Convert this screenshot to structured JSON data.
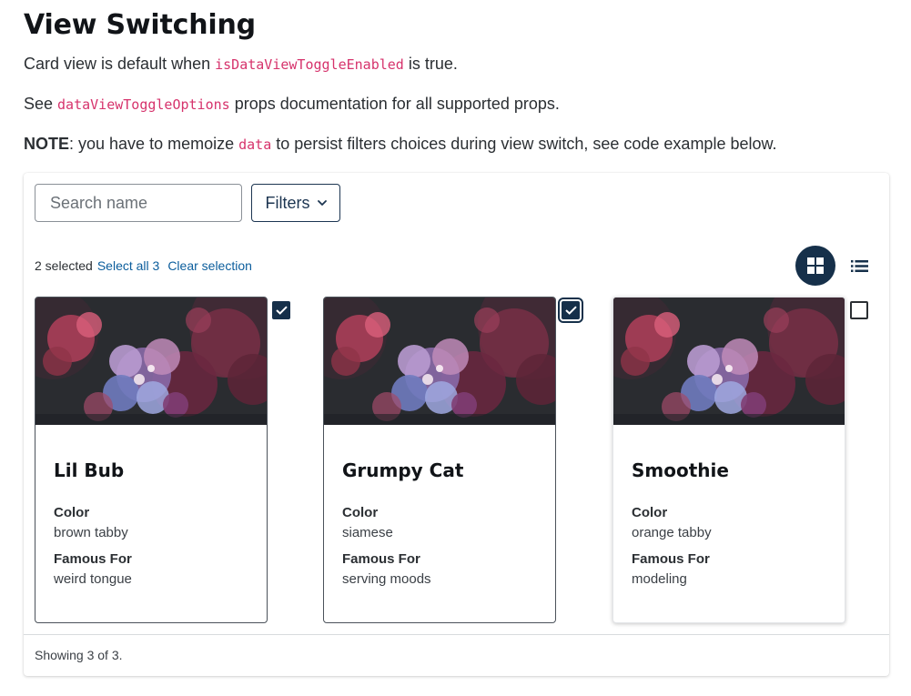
{
  "heading": "View Switching",
  "para1": {
    "before": "Card view is default when ",
    "code": "isDataViewToggleEnabled",
    "after": " is true."
  },
  "para2": {
    "before": "See ",
    "code": "dataViewToggleOptions",
    "after": " props documentation for all supported props."
  },
  "para3": {
    "bold": "NOTE",
    "before": ": you have to memoize ",
    "code": "data",
    "after": " to persist filters choices during view switch, see code example below."
  },
  "toolbar": {
    "search_placeholder": "Search name",
    "search_value": "",
    "filters_label": "Filters"
  },
  "selection": {
    "count_text": "2 selected",
    "select_all": "Select all 3",
    "clear": "Clear selection"
  },
  "view_toggle": {
    "active": "grid",
    "grid_icon": "grid-icon",
    "list_icon": "list-icon"
  },
  "cards": [
    {
      "name": "Lil Bub",
      "color_label": "Color",
      "color": "brown tabby",
      "famous_label": "Famous For",
      "famous": "weird tongue",
      "selected": true
    },
    {
      "name": "Grumpy Cat",
      "color_label": "Color",
      "color": "siamese",
      "famous_label": "Famous For",
      "famous": "serving moods",
      "selected": true
    },
    {
      "name": "Smoothie",
      "color_label": "Color",
      "color": "orange tabby",
      "famous_label": "Famous For",
      "famous": "modeling",
      "selected": false
    }
  ],
  "footer": "Showing 3 of 3.",
  "colors": {
    "accent": "#16304a",
    "link": "#0b5d9c",
    "code": "#d6336c"
  }
}
